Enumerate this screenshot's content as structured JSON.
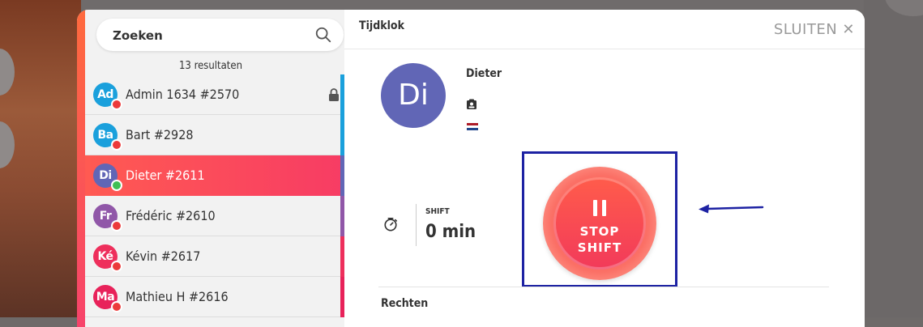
{
  "search": {
    "placeholder": "Zoeken"
  },
  "results_count": "13 resultaten",
  "colors": {
    "accent_start": "#ff6a3d",
    "accent_end": "#f7436b",
    "annotation": "#1d22a3",
    "status_red": "#ec3a3a",
    "status_green": "#3fbf55"
  },
  "users": [
    {
      "initials": "Ad",
      "label": "Admin 1634 #2570",
      "avatar_color": "#1aa0dc",
      "status": "red",
      "bar_color": "#1aa0dc",
      "locked": true,
      "active": false
    },
    {
      "initials": "Ba",
      "label": "Bart #2928",
      "avatar_color": "#1aa0dc",
      "status": "red",
      "bar_color": "#1aa0dc",
      "locked": false,
      "active": false
    },
    {
      "initials": "Di",
      "label": "Dieter #2611",
      "avatar_color": "#6166b6",
      "status": "green",
      "bar_color": "#6166b6",
      "locked": false,
      "active": true
    },
    {
      "initials": "Fr",
      "label": "Frédéric #2610",
      "avatar_color": "#9057a8",
      "status": "red",
      "bar_color": "#9057a8",
      "locked": false,
      "active": false
    },
    {
      "initials": "Ké",
      "label": "Kévin #2617",
      "avatar_color": "#ee2f5c",
      "status": "red",
      "bar_color": "#ee2f5c",
      "locked": false,
      "active": false
    },
    {
      "initials": "Ma",
      "label": "Mathieu H #2616",
      "avatar_color": "#e8225a",
      "status": "red",
      "bar_color": "#e8225a",
      "locked": false,
      "active": false
    }
  ],
  "panel": {
    "title": "Tijdklok",
    "close_label": "SLUITEN ✕",
    "user_initials": "Di",
    "user_name": "Dieter",
    "shift_label": "SHIFT",
    "shift_value": "0 min",
    "stop_line1": "STOP",
    "stop_line2": "SHIFT",
    "section_title": "Rechten"
  }
}
